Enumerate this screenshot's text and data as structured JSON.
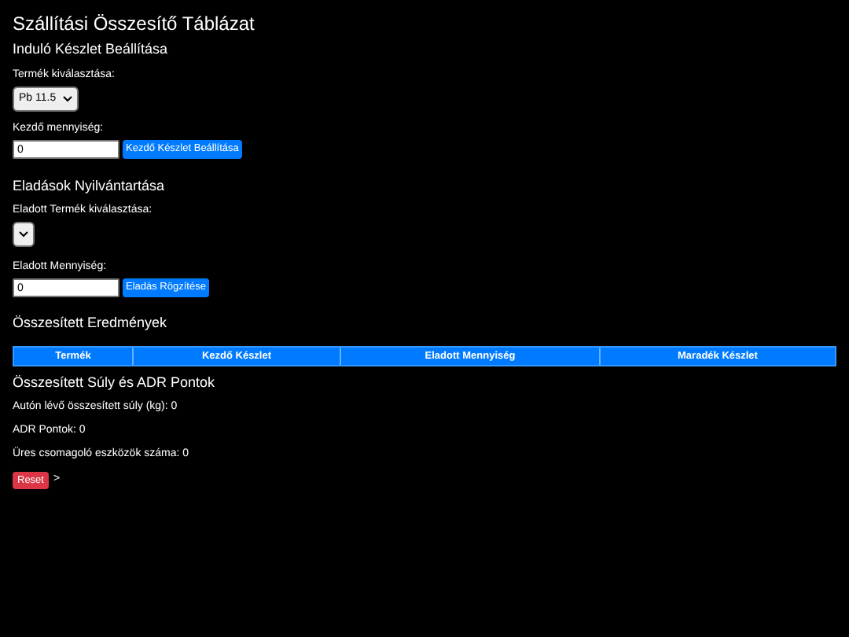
{
  "title": "Szállítási Összesítő Táblázat",
  "initial_stock": {
    "heading": "Induló Készlet Beállítása",
    "product_label": "Termék kiválasztása:",
    "product_value": "Pb 11.5",
    "quantity_label": "Kezdő mennyiség:",
    "quantity_value": "0",
    "button": "Kezdő Készlet Beállítása"
  },
  "sales": {
    "heading": "Eladások Nyilvántartása",
    "product_label": "Eladott Termék kiválasztása:",
    "quantity_label": "Eladott Mennyiség:",
    "quantity_value": "0",
    "button": "Eladás Rögzítése"
  },
  "results": {
    "heading": "Összesített Eredmények",
    "columns": [
      "Termék",
      "Kezdő Készlet",
      "Eladott Mennyiség",
      "Maradék Készlet"
    ]
  },
  "totals": {
    "heading": "Összesített Súly és ADR Pontok",
    "lines": [
      "Autón lévő összesített súly (kg): 0",
      "ADR Pontok: 0",
      "Üres csomagoló eszközök száma: 0"
    ]
  },
  "reset_button": "Reset",
  "trailing_text": ">"
}
